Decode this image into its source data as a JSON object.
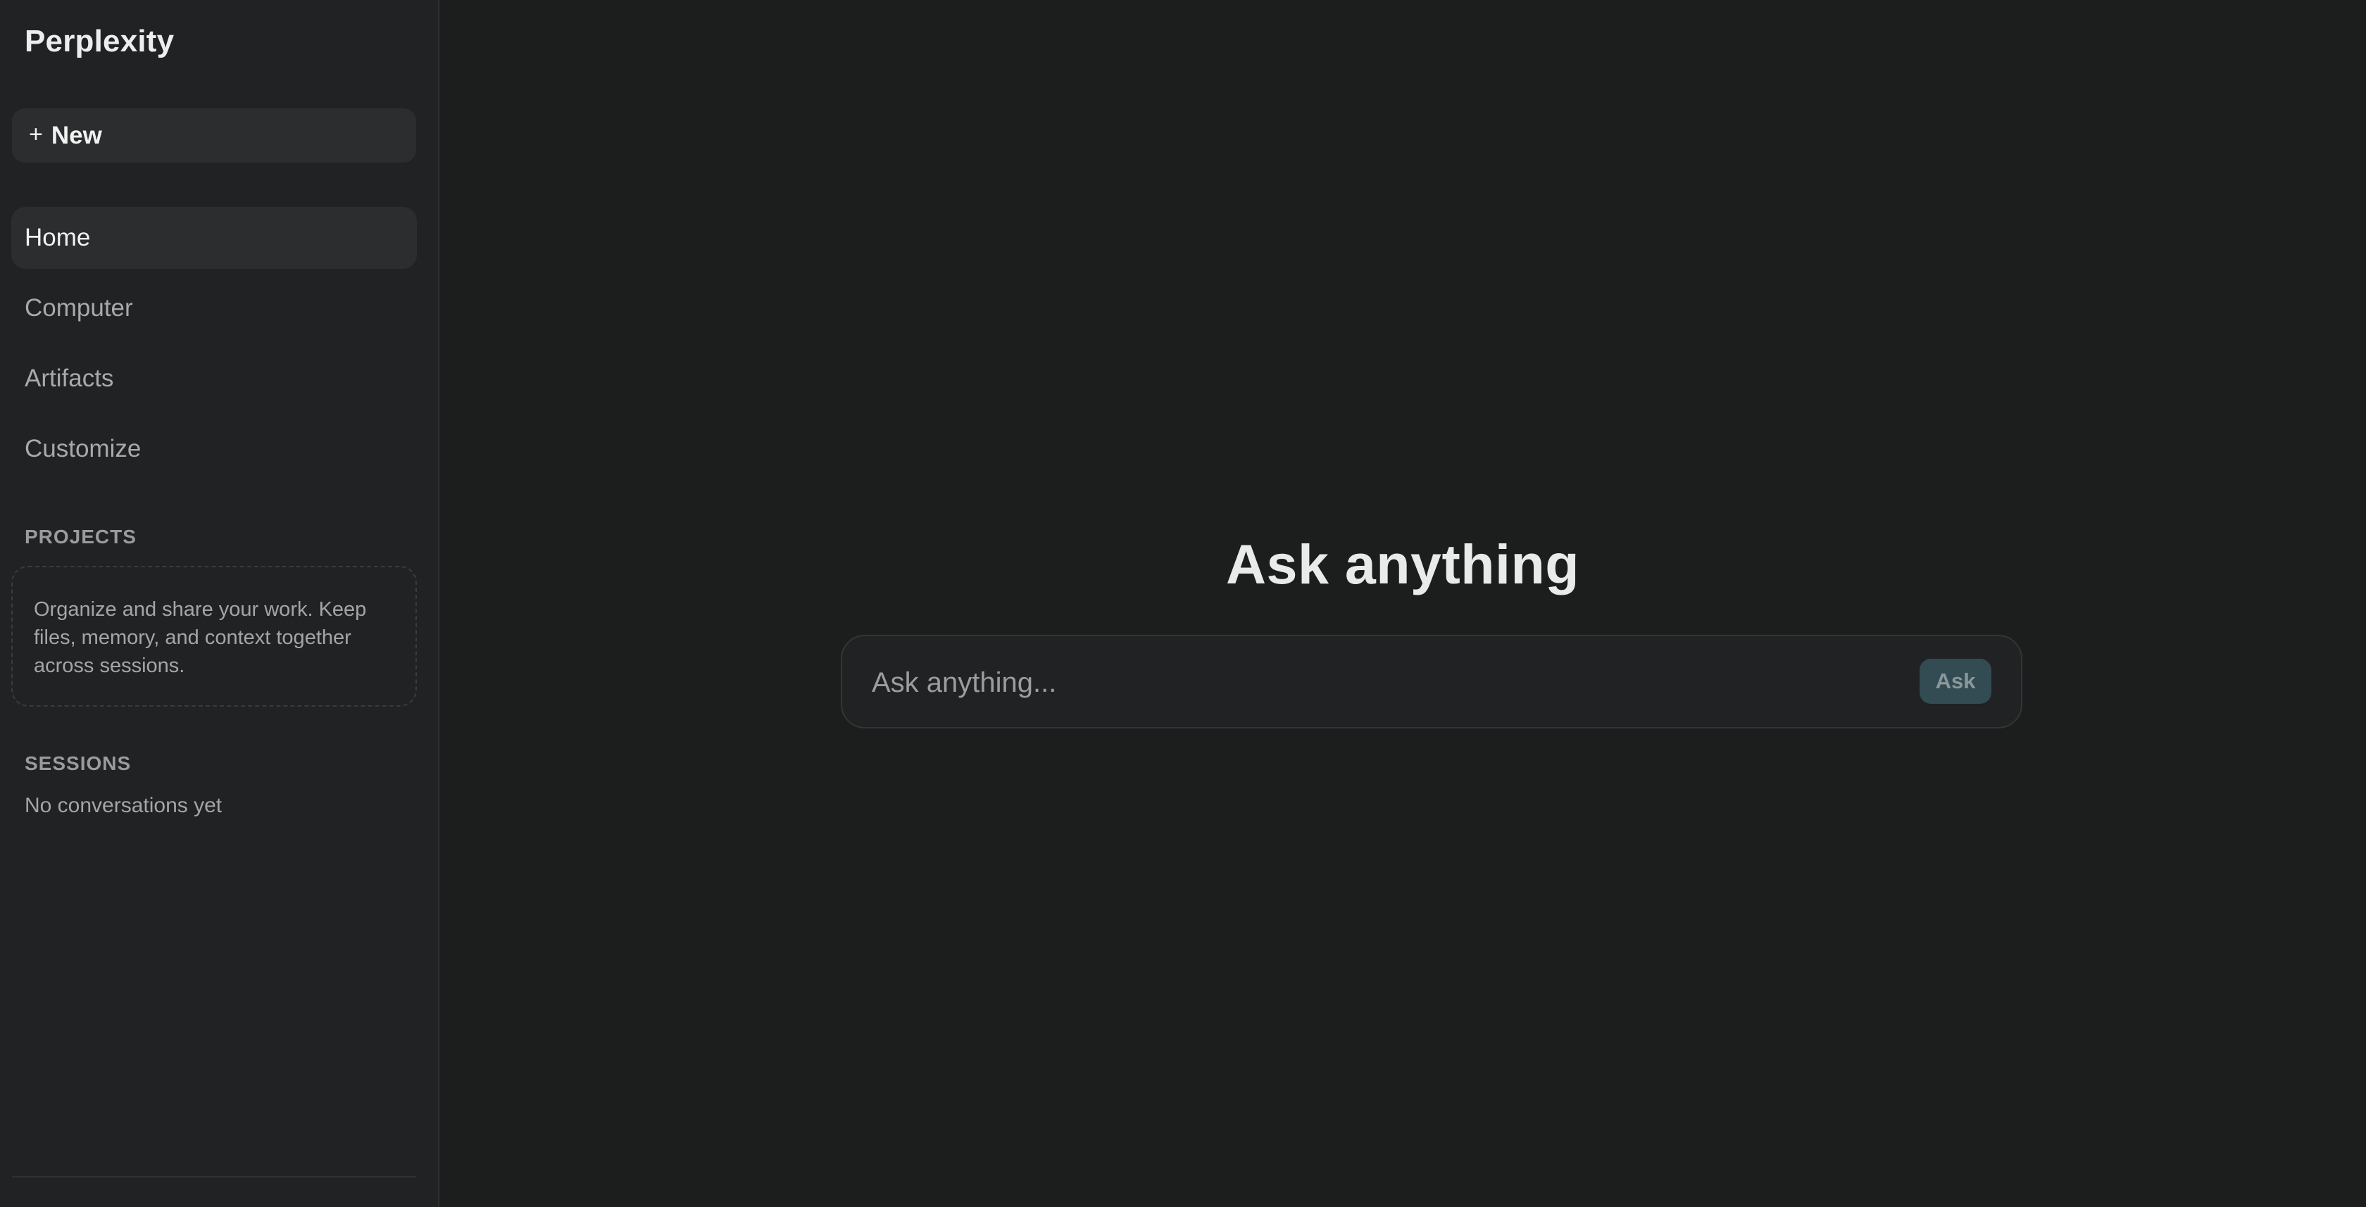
{
  "app": {
    "brand": "Perplexity"
  },
  "sidebar": {
    "new_button": {
      "icon": "plus-icon",
      "icon_glyph": "+",
      "label": "New"
    },
    "nav": [
      {
        "label": "Home",
        "active": true
      },
      {
        "label": "Computer",
        "active": false
      },
      {
        "label": "Artifacts",
        "active": false
      },
      {
        "label": "Customize",
        "active": false
      }
    ],
    "projects": {
      "heading": "PROJECTS",
      "empty_text": "Organize and share your work. Keep files, memory, and context together across sessions."
    },
    "sessions": {
      "heading": "SESSIONS",
      "empty_text": "No conversations yet"
    }
  },
  "main": {
    "title": "Ask anything",
    "search": {
      "placeholder": "Ask anything...",
      "value": "",
      "submit_label": "Ask"
    }
  },
  "colors": {
    "background": "#1c1d1d",
    "sidebar": "#212223",
    "active_item": "#2c2d2e",
    "ask_button": "#334b52"
  }
}
